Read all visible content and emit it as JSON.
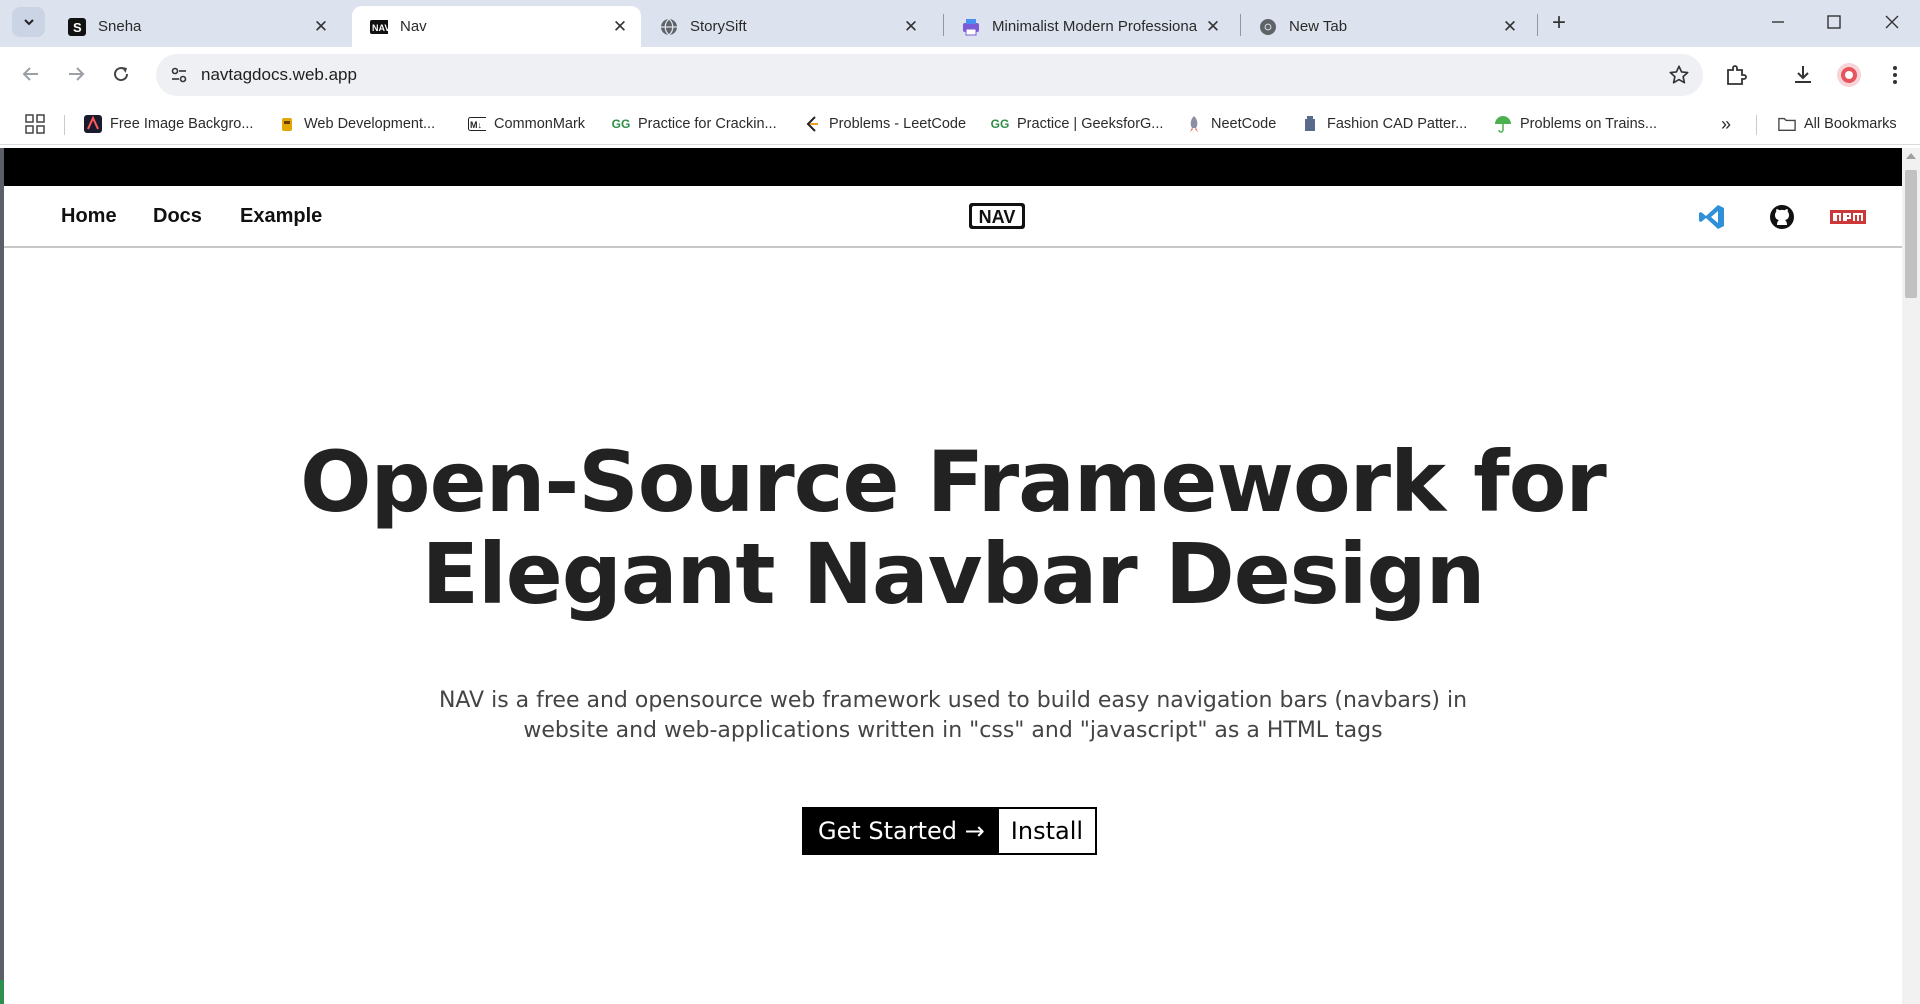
{
  "browser": {
    "tabs": [
      {
        "title": "Sneha",
        "active": false
      },
      {
        "title": "Nav",
        "active": true
      },
      {
        "title": "StorySift",
        "active": false
      },
      {
        "title": "Minimalist Modern Professional",
        "active": false
      },
      {
        "title": "New Tab",
        "active": false
      }
    ],
    "url": "navtagdocs.web.app",
    "bookmarks": [
      {
        "label": "Free Image Backgro..."
      },
      {
        "label": "Web Development..."
      },
      {
        "label": "CommonMark"
      },
      {
        "label": "Practice for Crackin..."
      },
      {
        "label": "Problems - LeetCode"
      },
      {
        "label": "Practice | GeeksforG..."
      },
      {
        "label": "NeetCode"
      },
      {
        "label": "Fashion CAD Patter..."
      },
      {
        "label": "Problems on Trains..."
      }
    ],
    "all_bookmarks_label": "All Bookmarks"
  },
  "site": {
    "nav_links": [
      "Home",
      "Docs",
      "Example"
    ],
    "logo_text": "NAV",
    "hero": {
      "title_line1": "Open-Source Framework for",
      "title_line2": "Elegant Navbar Design",
      "desc_line1": "NAV is a free and opensource web framework used to build easy navigation bars (navbars) in",
      "desc_line2": "website and web-applications written in \"css\" and \"javascript\" as a HTML tags"
    },
    "buttons": {
      "get_started": "Get Started →",
      "install": "Install"
    }
  },
  "colors": {
    "tabstrip": "#dde3ee",
    "topbar": "#000000",
    "vscode": "#2f8fd8",
    "npm": "#cb3837"
  }
}
